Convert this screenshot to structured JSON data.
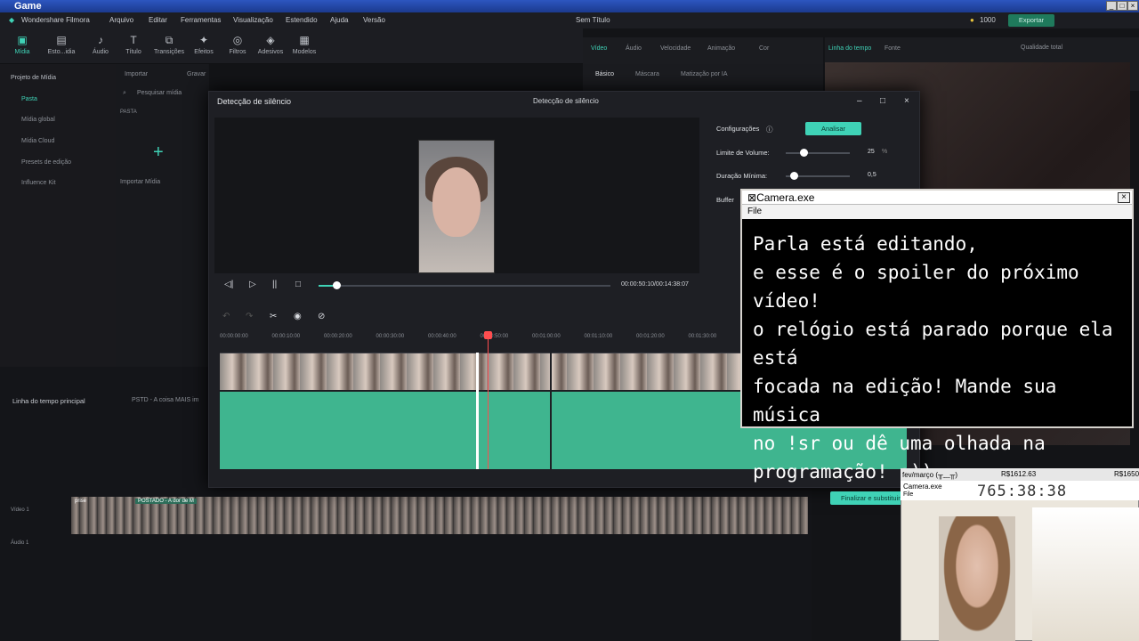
{
  "window": {
    "title": "Game"
  },
  "menu": {
    "app": "Wondershare Filmora",
    "items": [
      "Arquivo",
      "Editar",
      "Ferramentas",
      "Visualização",
      "Estendido",
      "Ajuda",
      "Versão"
    ],
    "doc_title": "Sem Título",
    "coins": "1000",
    "export": "Exportar"
  },
  "tools": [
    "Mídia",
    "Esto...idia",
    "Áudio",
    "Título",
    "Transições",
    "Efeitos",
    "Filtros",
    "Adesivos",
    "Modelos"
  ],
  "left": {
    "items": [
      "Projeto de Mídia",
      "Pasta",
      "Mídia global",
      "Mídia Cloud",
      "Presets de edição",
      "Influence Kit"
    ],
    "import_btn": "Importar",
    "record_btn": "Gravar",
    "search_placeholder": "Pesquisar mídia",
    "folder": "PASTA",
    "import_media": "Importar Mídia"
  },
  "props": {
    "tabs": [
      "Vídeo",
      "Áudio",
      "Velocidade",
      "Animação",
      "Cor"
    ],
    "subtabs": [
      "Básico",
      "Máscara",
      "Matização por IA"
    ],
    "preview_tab": "Linha do tempo",
    "preview_source": "Fonte",
    "quality": "Qualidade total"
  },
  "dialog": {
    "title": "Detecção de silêncio",
    "center_title": "Detecção de silêncio",
    "timecode": "00:00:50:10/00:14:38:07",
    "settings": "Configurações",
    "analyze": "Analisar",
    "volume_label": "Limite de Volume:",
    "volume_val": "25",
    "volume_unit": "%",
    "volume_pct": 0.28,
    "min_label": "Duração Mínima:",
    "min_val": "0,5",
    "min_pct": 0.12,
    "buffer_label": "Buffer",
    "finish": "Finalizar e substituir",
    "ruler": [
      "00:00:00:00",
      "00:00:10:00",
      "00:00:20:00",
      "00:00:30:00",
      "00:00:40:00",
      "00:00:50:00",
      "00:01:00:00",
      "00:01:10:00",
      "00:01:20:00",
      "00:01:30:00"
    ]
  },
  "timeline": {
    "main": "Linha do tempo principal",
    "clip": "PSTD - A coisa MAIS im",
    "video1": "Vídeo 1",
    "audio1": "Áudio 1",
    "clip_a": "prise",
    "clip_b": "POSTADO - A dor de M"
  },
  "camera": {
    "title": "Camera.exe",
    "file": "File",
    "lines": [
      "Parla está editando,",
      "e esse é o spoiler do próximo vídeo!",
      "o relógio está parado porque ela está",
      "focada na edição! Mande sua música",
      "no !sr ou dê uma olhada na",
      "programação!  :))"
    ]
  },
  "small": {
    "month": "fev/março (╥﹏╥)",
    "amount1": "R$1612.63",
    "amount2": "R$1650",
    "title": "Camera.exe",
    "file": "File",
    "counter": "765:38:38"
  }
}
